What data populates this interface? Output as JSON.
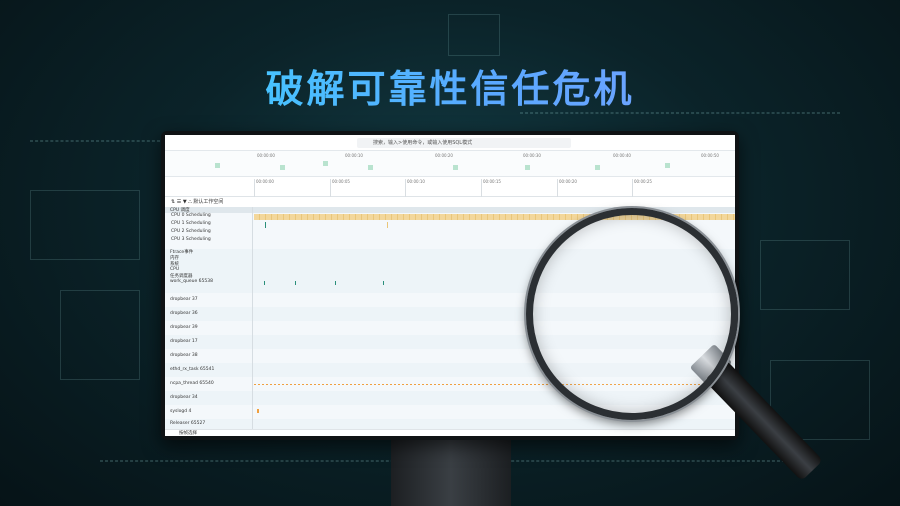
{
  "headline": "破解可靠性信任危机",
  "app": {
    "search_placeholder": "搜索，输入>使用命令，或输入使用SQL模式",
    "overview_ticks": [
      "00:00:00",
      "00:00:10",
      "00:00:20",
      "00:00:30",
      "00:00:40",
      "00:00:50"
    ],
    "ruler_ticks": [
      "00:00:00",
      "00:00:05",
      "00:00:10",
      "00:00:15",
      "00:00:20",
      "00:00:25"
    ],
    "toolbar_label": "默认工作空间",
    "sections": {
      "cpu": "CPU 调度",
      "cpu_rows": [
        "CPU 0 Scheduling",
        "CPU 1 Scheduling",
        "CPU 2 Scheduling",
        "CPU 3 Scheduling"
      ],
      "other": [
        "Ftrace事件",
        "内存",
        "系统",
        "CPU",
        "任务调度器"
      ]
    },
    "process_rows": [
      "work_queue 65538",
      "dropbear 37",
      "dropbear 36",
      "dropbear 39",
      "dropbear 17",
      "dropbear 38",
      "ethd_rx_task 65541",
      "ncpa_thread 65540",
      "dropbear 34",
      "syslogd 4",
      "Releaser 65527"
    ],
    "bottom_label": "按帧选择"
  }
}
